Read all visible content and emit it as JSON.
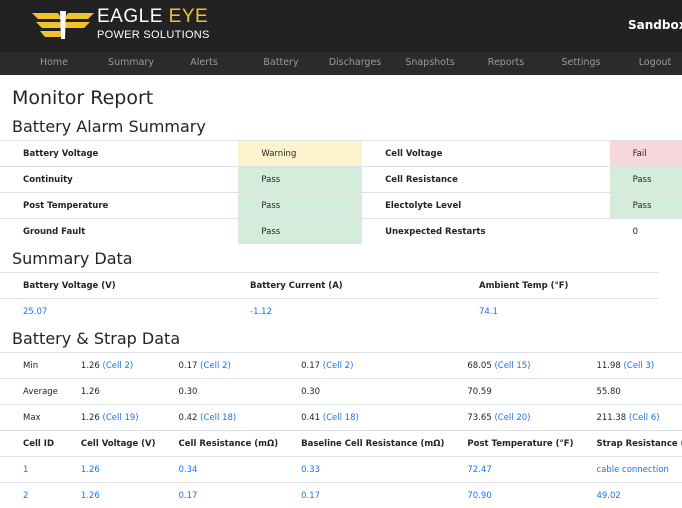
{
  "header": {
    "brand_line1a": "EAGLE",
    "brand_line1b": "EYE",
    "brand_line2": "POWER SOLUTIONS",
    "site": "Sandbox",
    "colors": {
      "bar": "#222222",
      "accent": "#f2c12e"
    }
  },
  "nav": [
    "Home",
    "Summary",
    "Alerts",
    "Battery",
    "Discharges",
    "Snapshots",
    "Reports",
    "Settings",
    "Logout"
  ],
  "page_title": "Monitor Report",
  "alarm": {
    "title": "Battery Alarm Summary",
    "rows": [
      {
        "l": "Battery Voltage",
        "ls": "Warning",
        "r": "Cell Voltage",
        "rs": "Fail"
      },
      {
        "l": "Continuity",
        "ls": "Pass",
        "r": "Cell Resistance",
        "rs": "Pass"
      },
      {
        "l": "Post Temperature",
        "ls": "Pass",
        "r": "Electolyte Level",
        "rs": "Pass"
      },
      {
        "l": "Ground Fault",
        "ls": "Pass",
        "r": "Unexpected Restarts",
        "rs": "0"
      }
    ]
  },
  "summary": {
    "title": "Summary Data",
    "headers": [
      "Battery Voltage (V)",
      "Battery Current (A)",
      "Ambient Temp (°F)"
    ],
    "values": [
      "25.07",
      "-1.12",
      "74.1"
    ]
  },
  "strap": {
    "title": "Battery & Strap Data",
    "stats": [
      {
        "label": "Min",
        "c": [
          [
            "1.26",
            "(Cell 2)"
          ],
          [
            "0.17",
            "(Cell 2)"
          ],
          [
            "0.17",
            "(Cell 2)"
          ],
          [
            "68.05",
            "(Cell 15)"
          ],
          [
            "11.98",
            "(Cell 3)"
          ]
        ]
      },
      {
        "label": "Average",
        "c": [
          [
            "1.26",
            ""
          ],
          [
            "0.30",
            ""
          ],
          [
            "0.30",
            ""
          ],
          [
            "70.59",
            ""
          ],
          [
            "55.80",
            ""
          ]
        ]
      },
      {
        "label": "Max",
        "c": [
          [
            "1.26",
            "(Cell 19)"
          ],
          [
            "0.42",
            "(Cell 18)"
          ],
          [
            "0.41",
            "(Cell 18)"
          ],
          [
            "73.65",
            "(Cell 20)"
          ],
          [
            "211.38",
            "(Cell 6)"
          ]
        ]
      }
    ],
    "headers": [
      "Cell ID",
      "Cell Voltage (V)",
      "Cell Resistance (mΩ)",
      "Baseline Cell Resistance (mΩ)",
      "Post Temperature (°F)",
      "Strap Resistance (µΩ)"
    ],
    "rows": [
      [
        "1",
        "1.26",
        "0.34",
        "0.33",
        "72.47",
        "cable connection"
      ],
      [
        "2",
        "1.26",
        "0.17",
        "0.17",
        "70.90",
        "49.02"
      ]
    ]
  }
}
